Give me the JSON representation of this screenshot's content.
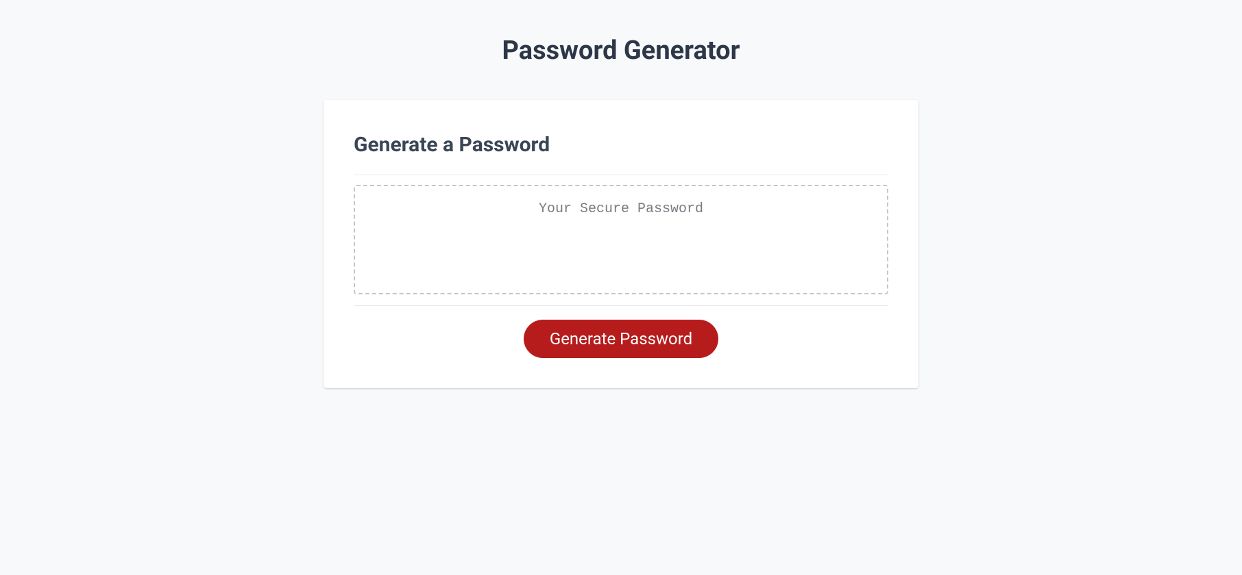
{
  "header": {
    "title": "Password Generator"
  },
  "card": {
    "title": "Generate a Password",
    "output": {
      "placeholder": "Your Secure Password",
      "value": ""
    },
    "button_label": "Generate Password"
  }
}
